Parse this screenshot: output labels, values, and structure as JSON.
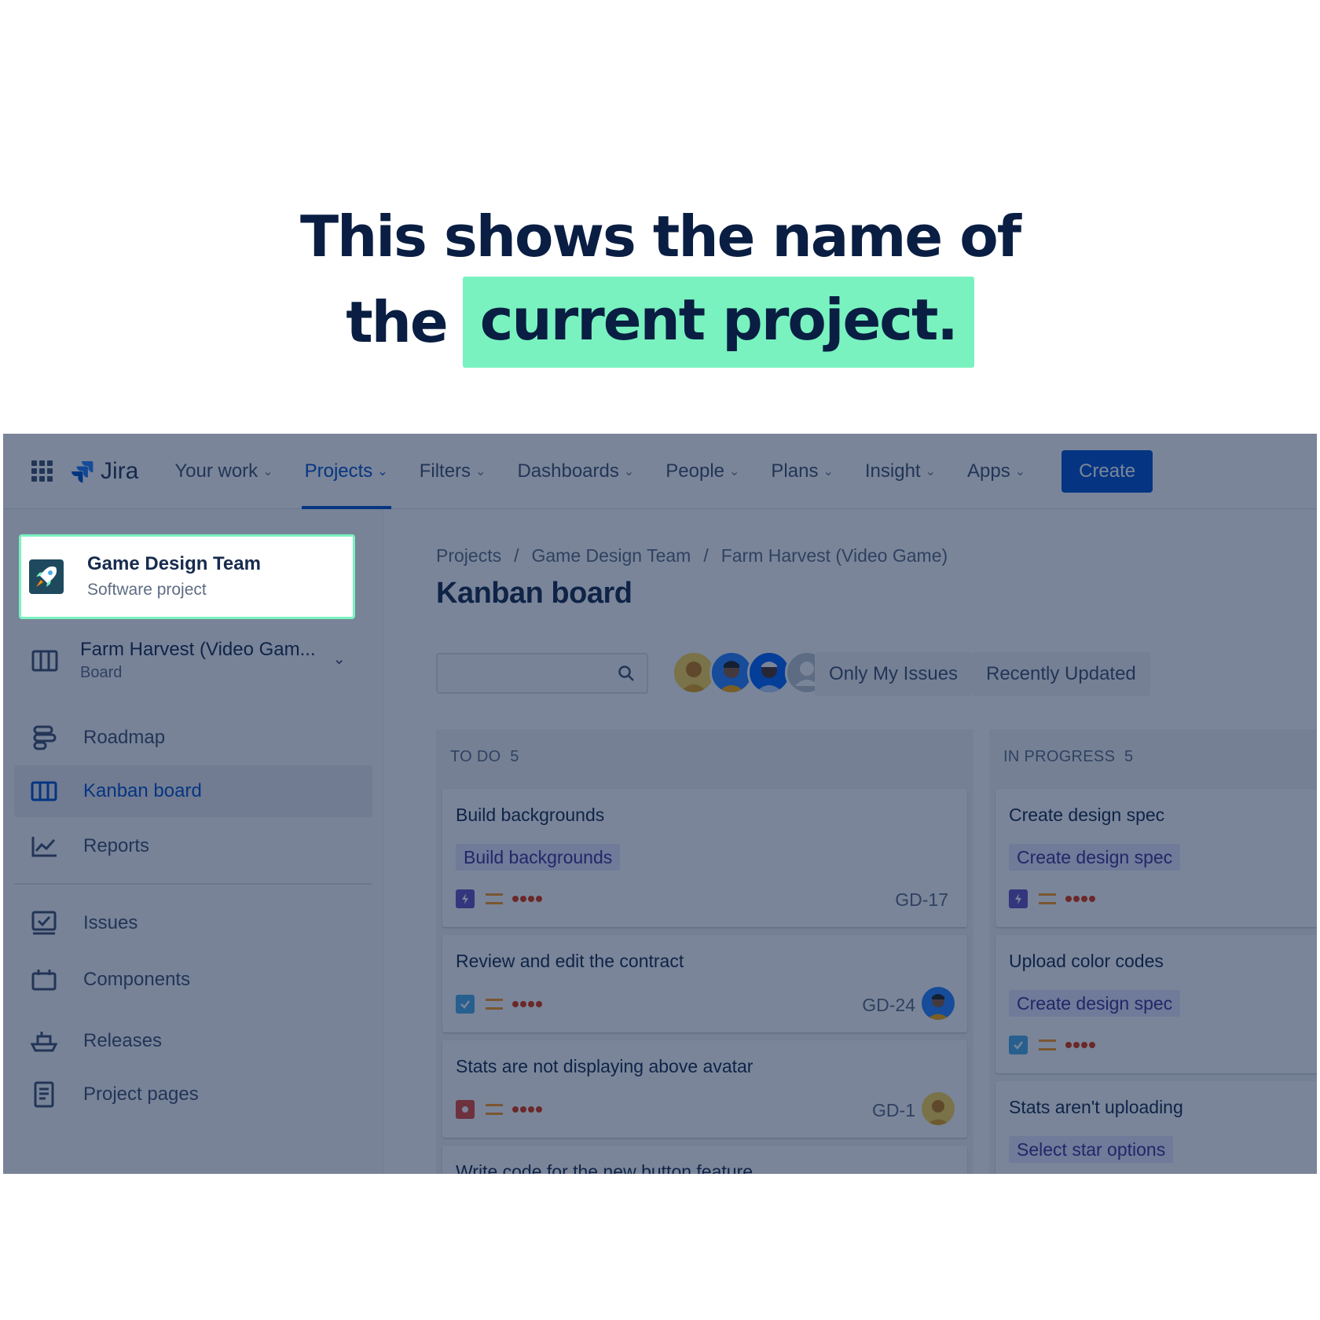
{
  "headline": {
    "line1": "This shows the name of",
    "line2_prefix": "the",
    "line2_highlight": "current project."
  },
  "topbar": {
    "logo": "Jira",
    "nav": [
      {
        "label": "Your work"
      },
      {
        "label": "Projects"
      },
      {
        "label": "Filters"
      },
      {
        "label": "Dashboards"
      },
      {
        "label": "People"
      },
      {
        "label": "Plans"
      },
      {
        "label": "Insight"
      },
      {
        "label": "Apps"
      }
    ],
    "create": "Create"
  },
  "sidebar": {
    "project": {
      "name": "Game Design Team",
      "type": "Software project"
    },
    "board": {
      "name": "Farm Harvest (Video Gam...",
      "sub": "Board"
    },
    "items": [
      {
        "label": "Roadmap",
        "icon": "roadmap-icon"
      },
      {
        "label": "Kanban board",
        "icon": "board-icon"
      },
      {
        "label": "Reports",
        "icon": "reports-icon"
      },
      {
        "label": "Issues",
        "icon": "issues-icon"
      },
      {
        "label": "Components",
        "icon": "components-icon"
      },
      {
        "label": "Releases",
        "icon": "releases-icon"
      },
      {
        "label": "Project pages",
        "icon": "pages-icon"
      }
    ]
  },
  "main": {
    "breadcrumb": [
      "Projects",
      "Game Design Team",
      "Farm Harvest (Video Game)"
    ],
    "breadcrumb_sep": "/",
    "title": "Kanban board",
    "filters": [
      "Only My Issues",
      "Recently Updated"
    ],
    "columns": [
      {
        "title": "TO DO",
        "count": "5",
        "cards": [
          {
            "title": "Build backgrounds",
            "epic": "Build backgrounds",
            "type": "epic-icon",
            "key": "GD-17"
          },
          {
            "title": "Review and edit the contract",
            "type": "task-icon",
            "key": "GD-24"
          },
          {
            "title": "Stats are not displaying above avatar",
            "type": "bug-icon",
            "key": "GD-1"
          },
          {
            "title": "Write code for the new button feature"
          }
        ]
      },
      {
        "title": "IN PROGRESS",
        "count": "5",
        "cards": [
          {
            "title": "Create design spec",
            "epic": "Create design spec",
            "type": "epic-icon"
          },
          {
            "title": "Upload color codes",
            "epic": "Create design spec",
            "type": "task-icon"
          },
          {
            "title": "Stats aren't uploading",
            "epic": "Select star options"
          }
        ]
      }
    ]
  },
  "colors": {
    "accent": "#0052cc",
    "highlight": "#79f2c0",
    "overlay": "rgba(9,30,66,0.54)",
    "epic_bg": "#eae6ff",
    "epic_fg": "#403294"
  }
}
